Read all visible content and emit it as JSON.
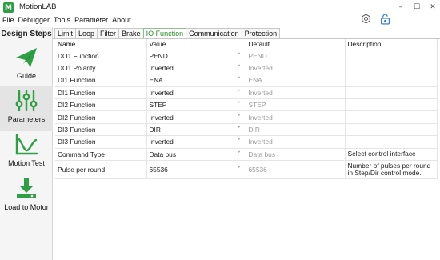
{
  "app": {
    "logo_letter": "M",
    "title": "MotionLAB"
  },
  "window_controls": {
    "minimize": "–",
    "maximize": "☐",
    "close": "✕"
  },
  "menu": [
    "File",
    "Debugger",
    "Tools",
    "Parameter",
    "About"
  ],
  "toolbar": {
    "settings_icon": "gear-icon",
    "lock_icon": "unlock-icon"
  },
  "sidebar": {
    "title": "Design Steps",
    "steps": [
      {
        "label": "Guide",
        "icon": "paper-plane-icon",
        "active": false
      },
      {
        "label": "Parameters",
        "icon": "sliders-icon",
        "active": true
      },
      {
        "label": "Motion Test",
        "icon": "curve-chart-icon",
        "active": false
      },
      {
        "label": "Load to Motor",
        "icon": "download-icon",
        "active": false
      }
    ]
  },
  "accent_color": "#2ea043",
  "tabs": [
    "Limit",
    "Loop",
    "Filter",
    "Brake",
    "IO Function",
    "Communication",
    "Protection"
  ],
  "active_tab": "IO Function",
  "table": {
    "columns": [
      "Name",
      "Value",
      "Default",
      "Description"
    ],
    "rows": [
      {
        "name": "DO1 Function",
        "value": "PEND",
        "default": "PEND",
        "description": ""
      },
      {
        "name": "DO1 Polarity",
        "value": "Inverted",
        "default": "Inverted",
        "description": ""
      },
      {
        "name": "DI1 Function",
        "value": "ENA",
        "default": "ENA",
        "description": ""
      },
      {
        "name": "DI1 Function",
        "value": "Inverted",
        "default": "Inverted",
        "description": ""
      },
      {
        "name": "DI2 Function",
        "value": "STEP",
        "default": "STEP",
        "description": ""
      },
      {
        "name": "DI2 Function",
        "value": "Inverted",
        "default": "Inverted",
        "description": ""
      },
      {
        "name": "DI3 Function",
        "value": "DIR",
        "default": "DIR",
        "description": ""
      },
      {
        "name": "DI3 Function",
        "value": "Inverted",
        "default": "Inverted",
        "description": ""
      },
      {
        "name": "Command Type",
        "value": "Data bus",
        "default": "Data bus",
        "description": "Select control interface"
      },
      {
        "name": "Pulse per round",
        "value": "65536",
        "default": "65536",
        "description": "Number of pulses per round in Step/Dir control mode."
      }
    ]
  }
}
